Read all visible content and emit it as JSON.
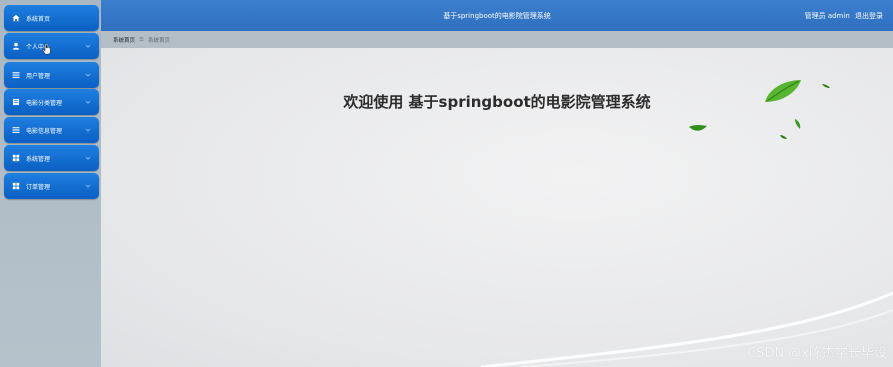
{
  "app": {
    "title": "基于springboot的电影院管理系统"
  },
  "header": {
    "user_label": "管理员 admin",
    "logout_label": "退出登录"
  },
  "breadcrumb": {
    "home": "系统首页",
    "separator": "☰",
    "current": "系统首页"
  },
  "sidebar": {
    "items": [
      {
        "label": "系统首页",
        "icon": "home-icon"
      },
      {
        "label": "个人中心",
        "icon": "user-icon"
      },
      {
        "label": "用户管理",
        "icon": "menu-icon"
      },
      {
        "label": "电影分类管理",
        "icon": "book-icon"
      },
      {
        "label": "电影信息管理",
        "icon": "menu-icon"
      },
      {
        "label": "系统管理",
        "icon": "grid-icon"
      },
      {
        "label": "订单管理",
        "icon": "grid-icon"
      }
    ]
  },
  "main": {
    "welcome": "欢迎使用 基于springboot的电影院管理系统"
  },
  "watermark": "CSDN @x陈杰学长毕设",
  "colors": {
    "accent": "#0a6fd6",
    "header": "#3a7bcc",
    "sidebar_bg": "#b0bdc7",
    "leaf": "#4caf2a"
  }
}
